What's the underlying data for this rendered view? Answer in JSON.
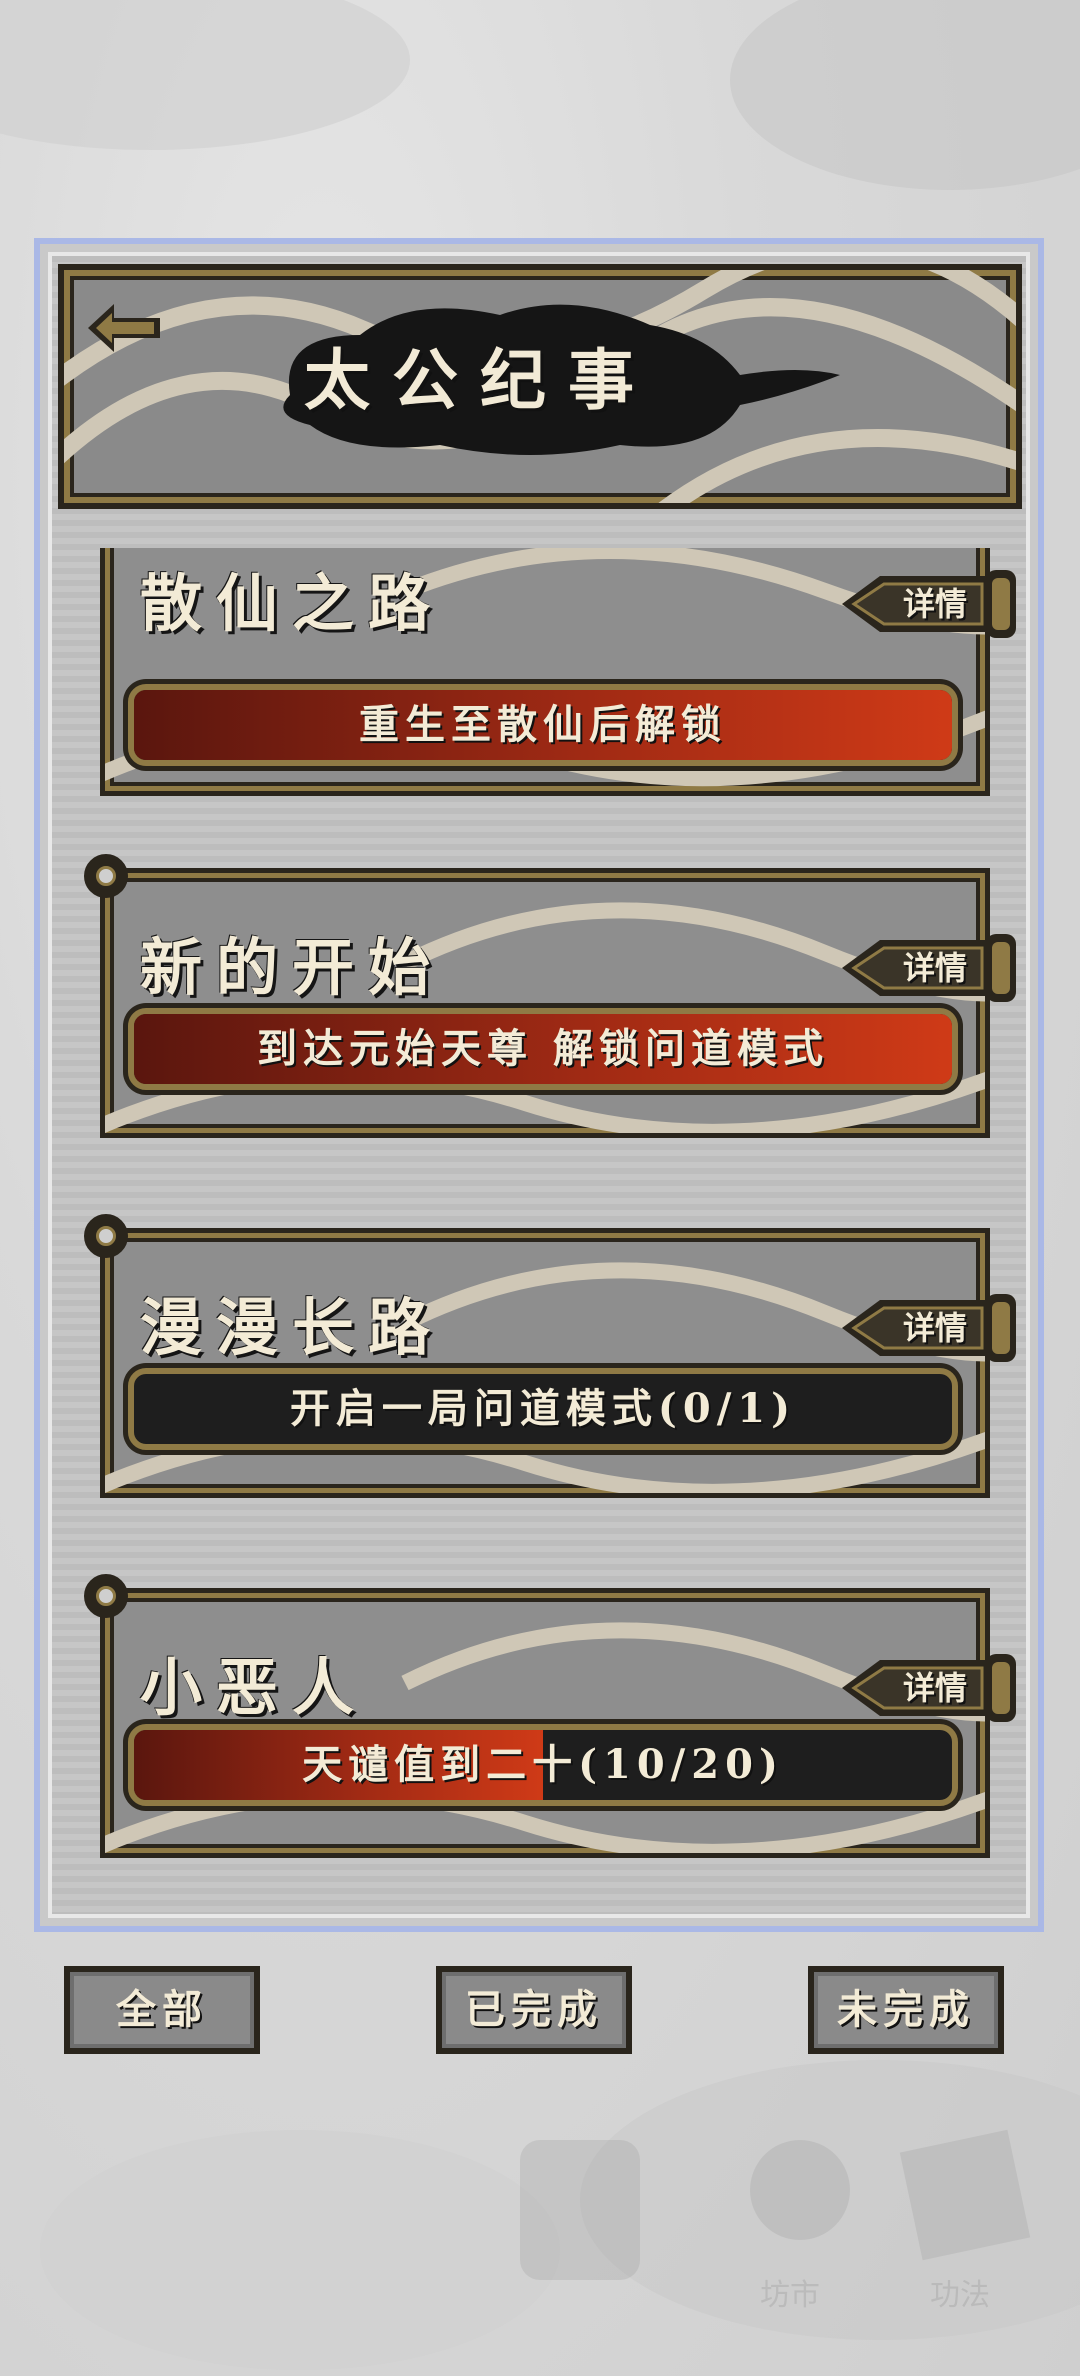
{
  "header": {
    "title": "太公纪事",
    "back_icon": "back-arrow-icon"
  },
  "achievements": [
    {
      "title": "散仙之路",
      "detail_label": "详情",
      "progress_text": "重生至散仙后解锁",
      "progress_fraction": 1.0
    },
    {
      "title": "新的开始",
      "detail_label": "详情",
      "progress_text": "到达元始天尊 解锁问道模式",
      "progress_fraction": 1.0
    },
    {
      "title": "漫漫长路",
      "detail_label": "详情",
      "progress_text": "开启一局问道模式(0/1)",
      "progress_fraction": 0.0
    },
    {
      "title": "小恶人",
      "detail_label": "详情",
      "progress_text": "天谴值到二十(10/20)",
      "progress_fraction": 0.5
    }
  ],
  "filters": {
    "all": "全部",
    "completed": "已完成",
    "incomplete": "未完成"
  },
  "background_nav": {
    "market": "坊市",
    "skills": "功法"
  },
  "colors": {
    "frame_dark": "#2a251c",
    "frame_gold": "#8f7a45",
    "progress_red": "#cf3a17",
    "panel_border": "#aab8e6"
  }
}
